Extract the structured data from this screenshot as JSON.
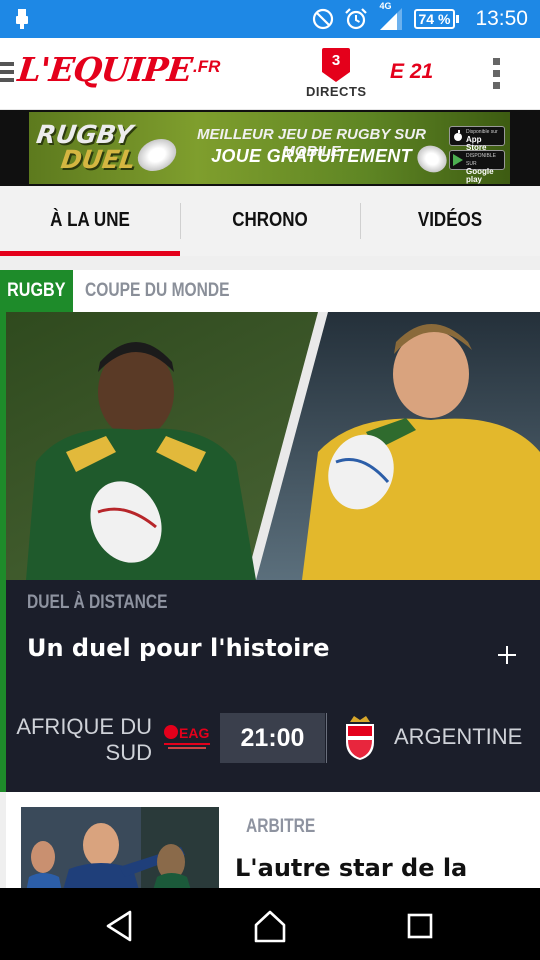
{
  "status_bar": {
    "network": "4G",
    "battery": "74 %",
    "time": "13:50"
  },
  "app_bar": {
    "logo": "L'EQUIPE",
    "logo_suffix": ".FR",
    "directs_count": "3",
    "directs_label": "DIRECTS",
    "e21_label": "E 21"
  },
  "ad": {
    "title_line1": "RUGBY",
    "title_line2": "DUEL",
    "line1": "MEILLEUR JEU DE RUGBY SUR MOBILE",
    "line2": "JOUE GRATUITEMENT",
    "appstore_small": "Disponible sur",
    "appstore_main": "App Store",
    "googleplay_small": "DISPONIBLE SUR",
    "googleplay_main": "Google play"
  },
  "tabs": [
    {
      "label": "À LA UNE",
      "active": true
    },
    {
      "label": "CHRONO",
      "active": false
    },
    {
      "label": "VIDÉOS",
      "active": false
    }
  ],
  "category": {
    "sport": "RUGBY",
    "competition": "COUPE DU MONDE"
  },
  "featured": {
    "kicker": "DUEL À DISTANCE",
    "headline": "Un duel pour l'histoire",
    "match": {
      "home_team": "AFRIQUE DU SUD",
      "time": "21:00",
      "away_team": "ARGENTINE",
      "sponsor": "EAG"
    }
  },
  "second_article": {
    "kicker": "ARBITRE",
    "headline": "L'autre star de la"
  },
  "colors": {
    "status_bar": "#1e88e5",
    "brand_red": "#e4001b",
    "rugby_green": "#1e8b2a",
    "card_dark": "#1b1e2a"
  },
  "icons": {
    "status": [
      "usb-icon",
      "do-not-disturb-icon",
      "alarm-icon",
      "signal-icon",
      "battery-icon"
    ],
    "app_bar": [
      "menu-icon",
      "directs-badge-icon",
      "overflow-menu-icon"
    ],
    "nav": [
      "back-icon",
      "home-icon",
      "recents-icon"
    ]
  }
}
